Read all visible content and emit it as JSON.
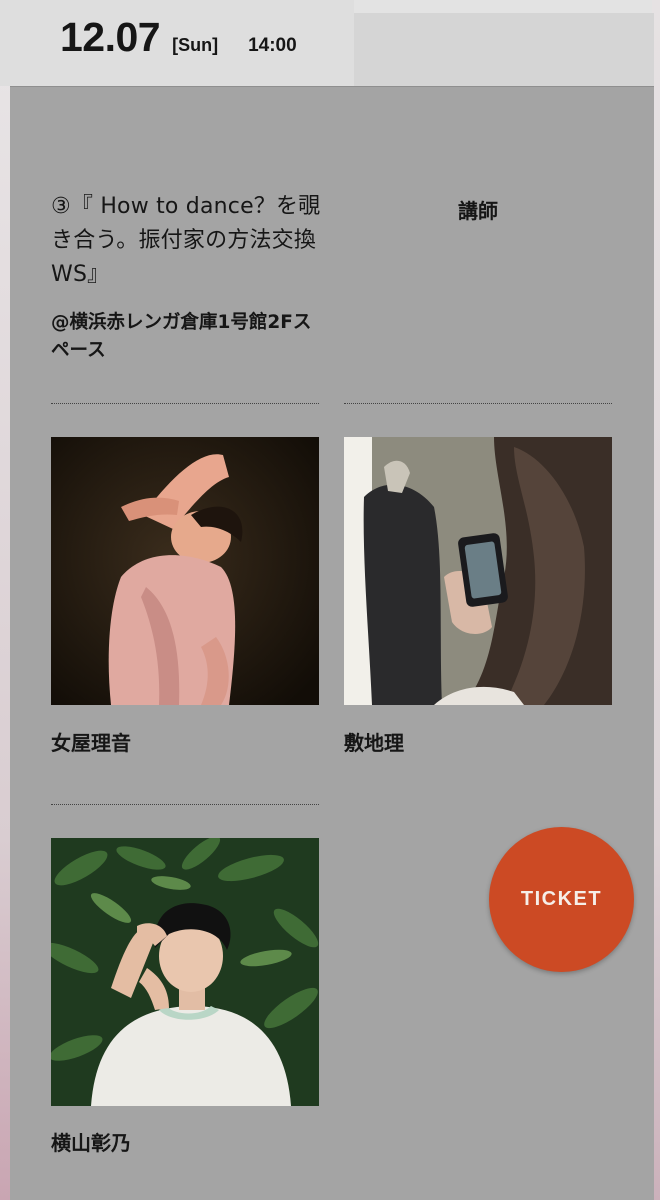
{
  "header": {
    "date": "12.07",
    "day_of_week": "[Sun]",
    "time": "14:00"
  },
  "event": {
    "title": "③『 How to dance？を覗き合う。振付家の方法交換WS』",
    "venue": "@横浜赤レンガ倉庫1号館2Fスペース",
    "lecturer_heading": "講師"
  },
  "lecturers": [
    {
      "name": "女屋理音",
      "photo": "dancer-photo"
    },
    {
      "name": "敷地理",
      "photo": "phone-photo"
    },
    {
      "name": "横山彰乃",
      "photo": "portrait-photo"
    }
  ],
  "ticket": {
    "label": "TICKET",
    "color": "#cc4a24"
  },
  "colors": {
    "panel": "#a4a4a4",
    "tab": "#dedede",
    "background": "#e3e3e3"
  }
}
